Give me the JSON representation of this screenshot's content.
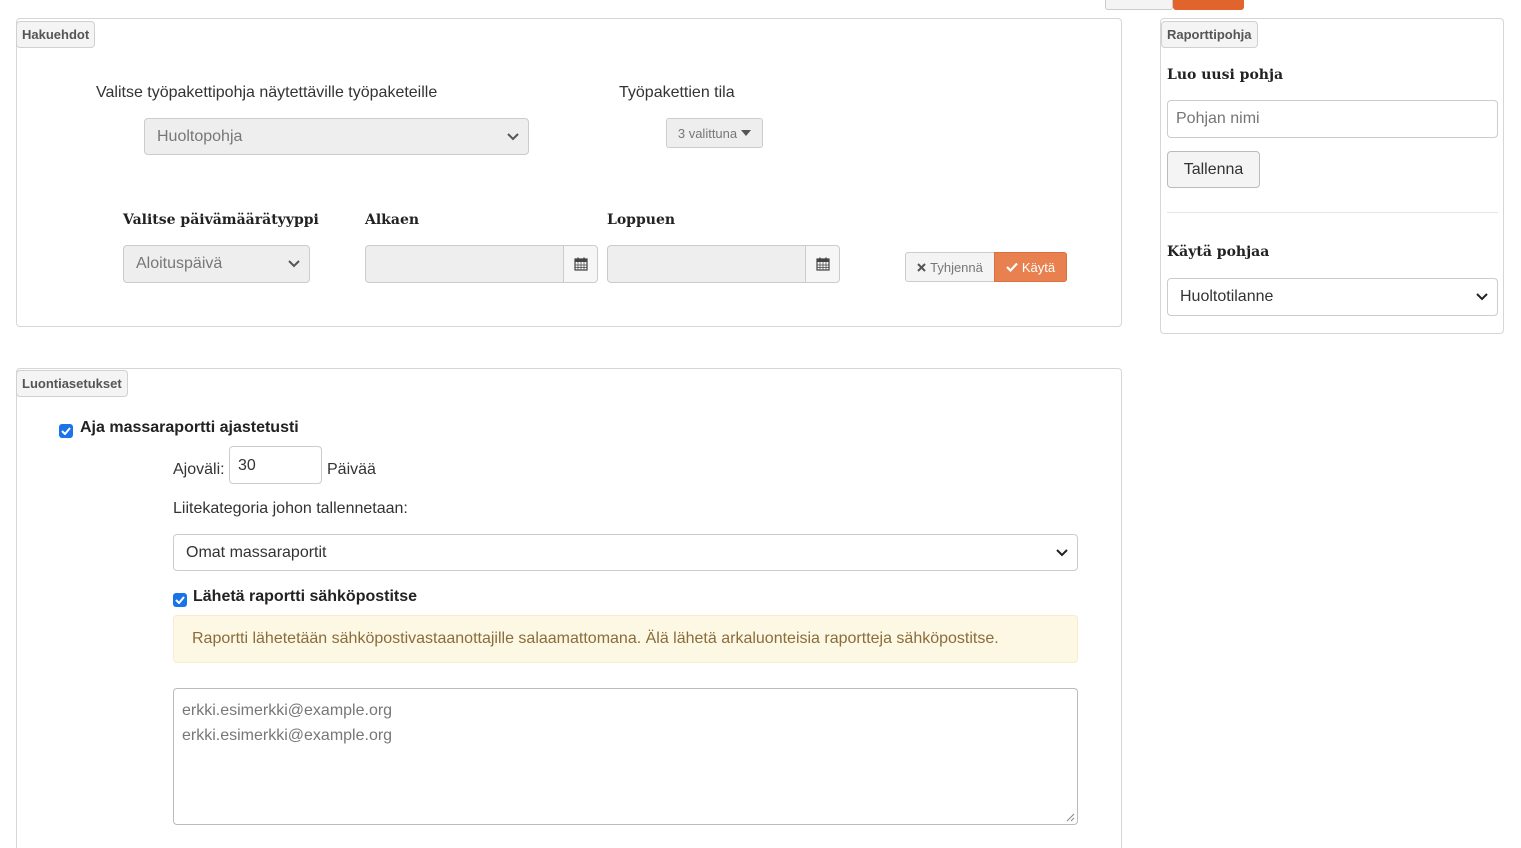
{
  "search_panel": {
    "legend": "Hakuehdot",
    "template_label": "Valitse työpakettipohja näytettäville työpaketeille",
    "template_value": "Huoltopohja",
    "status_label": "Työpakettien tila",
    "status_value": "3 valittuna",
    "date_type_label": "Valitse päivämäärätyyppi",
    "date_type_value": "Aloituspäivä",
    "from_label": "Alkaen",
    "to_label": "Loppuen",
    "clear_button": "Tyhjennä",
    "apply_button": "Käytä"
  },
  "report_template": {
    "legend": "Raporttipohja",
    "create_title": "Luo uusi pohja",
    "name_placeholder": "Pohjan nimi",
    "save_button": "Tallenna",
    "use_title": "Käytä pohjaa",
    "use_value": "Huoltotilanne"
  },
  "creation": {
    "legend": "Luontiasetukset",
    "schedule_label": "Aja massaraportti ajastetusti",
    "interval_label": "Ajoväli:",
    "interval_value": "30",
    "interval_unit": "Päivää",
    "category_label": "Liitekategoria johon tallennetaan:",
    "category_value": "Omat massaraportit",
    "email_label": "Lähetä raportti sähköpostitse",
    "warning": "Raportti lähetetään sähköpostivastaanottajille salaamattomana. Älä lähetä arkaluonteisia raportteja sähköpostitse.",
    "recipients": [
      "erkki.esimerkki@example.org",
      "erkki.esimerkki@example.org"
    ]
  },
  "colors": {
    "accent": "#e8804f",
    "checkbox": "#1a73e8",
    "warning_bg": "#fcf8e3",
    "warning_text": "#8a6d3b"
  }
}
